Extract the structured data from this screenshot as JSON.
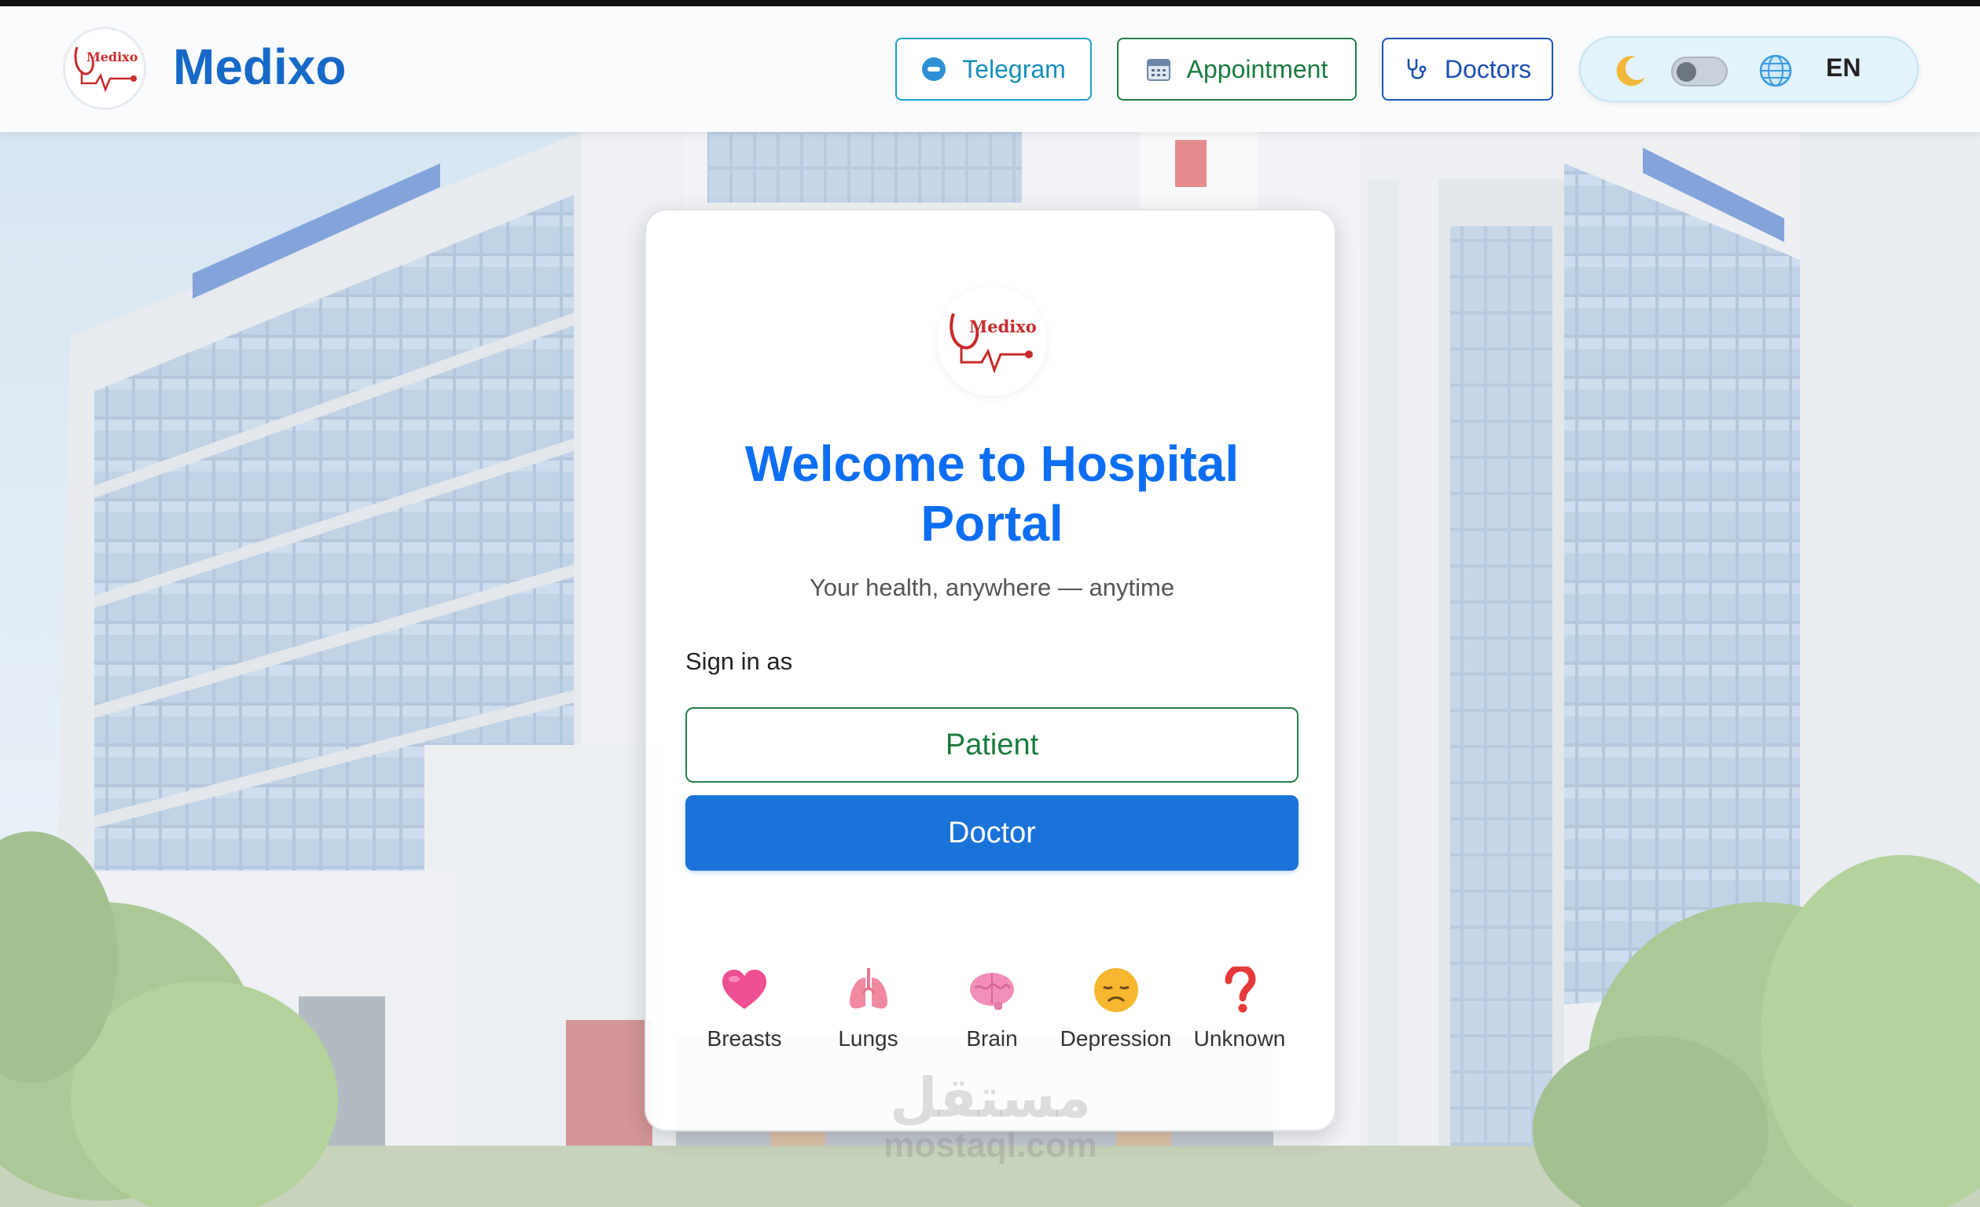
{
  "header": {
    "brand_name": "Medixo",
    "nav": {
      "telegram": "Telegram",
      "appointment": "Appointment",
      "doctors": "Doctors"
    },
    "language": "EN",
    "dark_mode": false
  },
  "card": {
    "title": "Welcome to Hospital Portal",
    "subtitle": "Your health, anywhere — anytime",
    "sign_in_label": "Sign in as",
    "patient_button": "Patient",
    "doctor_button": "Doctor",
    "categories": [
      {
        "label": "Breasts",
        "icon": "heart-icon"
      },
      {
        "label": "Lungs",
        "icon": "lungs-icon"
      },
      {
        "label": "Brain",
        "icon": "brain-icon"
      },
      {
        "label": "Depression",
        "icon": "sad-face-icon"
      },
      {
        "label": "Unknown",
        "icon": "question-mark-icon"
      }
    ]
  },
  "watermark": {
    "arabic": "مستقل",
    "latin": "mostaql.com"
  },
  "colors": {
    "brand_blue": "#1769c8",
    "title_blue": "#0d6ef3",
    "doctor_button": "#1a73d9",
    "patient_green": "#1b7a3f"
  }
}
